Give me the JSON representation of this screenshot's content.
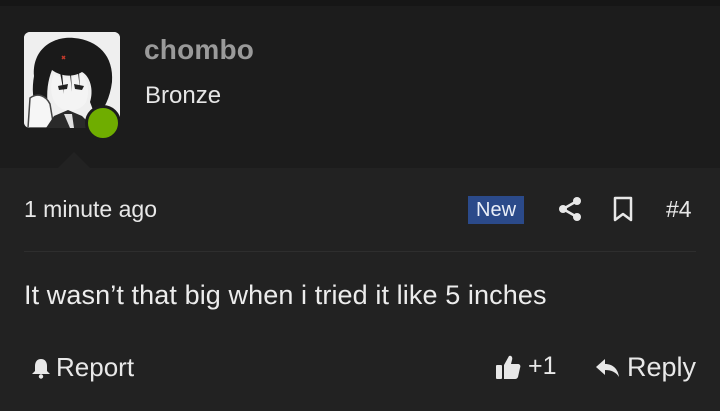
{
  "user": {
    "name": "chombo",
    "rank": "Bronze",
    "status_color": "#6fad00"
  },
  "post": {
    "time": "1 minute ago",
    "badge": "New",
    "number": "#4",
    "message": "It wasn’t that big when i tried it like 5 inches"
  },
  "actions": {
    "report_label": "Report",
    "like_count": "+1",
    "reply_label": "Reply"
  },
  "icons": {
    "share": "share-icon",
    "bookmark": "bookmark-icon",
    "report": "bell-icon",
    "like": "thumbs-up-icon",
    "reply": "reply-arrow-icon"
  },
  "colors": {
    "background": "#1c1c1c",
    "post_background": "#222222",
    "badge_background": "#2b4a8a",
    "username": "#9a9a9a"
  }
}
